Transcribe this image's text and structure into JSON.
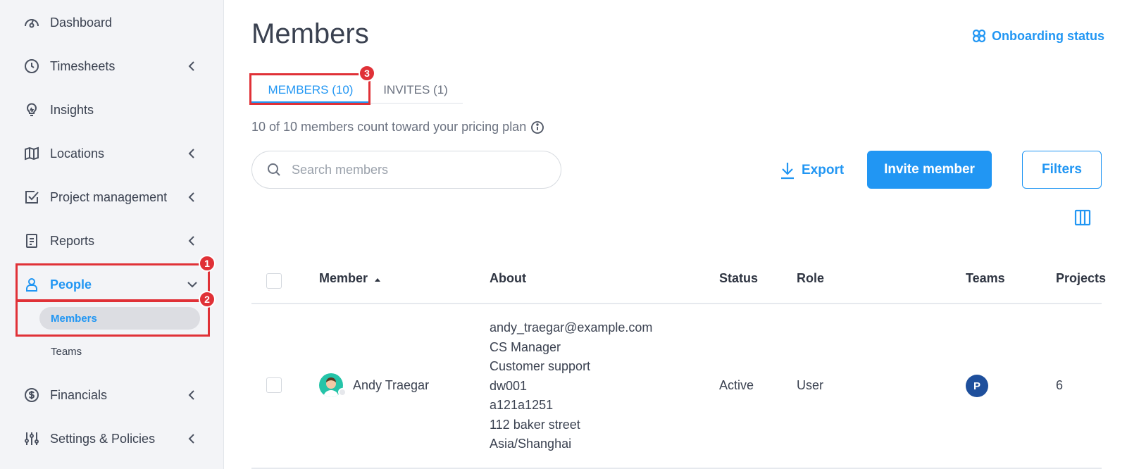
{
  "sidebar": {
    "items": [
      {
        "label": "Dashboard",
        "icon": "dashboard-icon"
      },
      {
        "label": "Timesheets",
        "icon": "clock-icon"
      },
      {
        "label": "Insights",
        "icon": "lightbulb-icon"
      },
      {
        "label": "Locations",
        "icon": "map-icon"
      },
      {
        "label": "Project management",
        "icon": "checkbox-icon"
      },
      {
        "label": "Reports",
        "icon": "report-icon"
      },
      {
        "label": "People",
        "icon": "person-icon"
      },
      {
        "label": "Financials",
        "icon": "dollar-icon"
      },
      {
        "label": "Settings & Policies",
        "icon": "sliders-icon"
      }
    ],
    "people_sub": {
      "members": "Members",
      "teams": "Teams"
    }
  },
  "annotations": {
    "badge1": "1",
    "badge2": "2",
    "badge3": "3"
  },
  "header": {
    "title": "Members",
    "onboarding": "Onboarding status"
  },
  "tabs": {
    "members": "MEMBERS (10)",
    "invites": "INVITES (1)"
  },
  "info": {
    "text": "10 of 10 members count toward your pricing plan"
  },
  "search": {
    "placeholder": "Search members"
  },
  "toolbar": {
    "export": "Export",
    "invite": "Invite member",
    "filters": "Filters"
  },
  "table": {
    "headers": {
      "member": "Member",
      "about": "About",
      "status": "Status",
      "role": "Role",
      "teams": "Teams",
      "projects": "Projects"
    },
    "rows": [
      {
        "name": "Andy Traegar",
        "about": [
          "andy_traegar@example.com",
          "CS Manager",
          "Customer support",
          "dw001",
          "a121a1251",
          "112 baker street",
          "Asia/Shanghai"
        ],
        "status": "Active",
        "role": "User",
        "team_initial": "P",
        "projects": "6"
      }
    ]
  },
  "colors": {
    "accent": "#2196f3",
    "annotation": "#e03137",
    "team_badge": "#1e4f9c"
  }
}
